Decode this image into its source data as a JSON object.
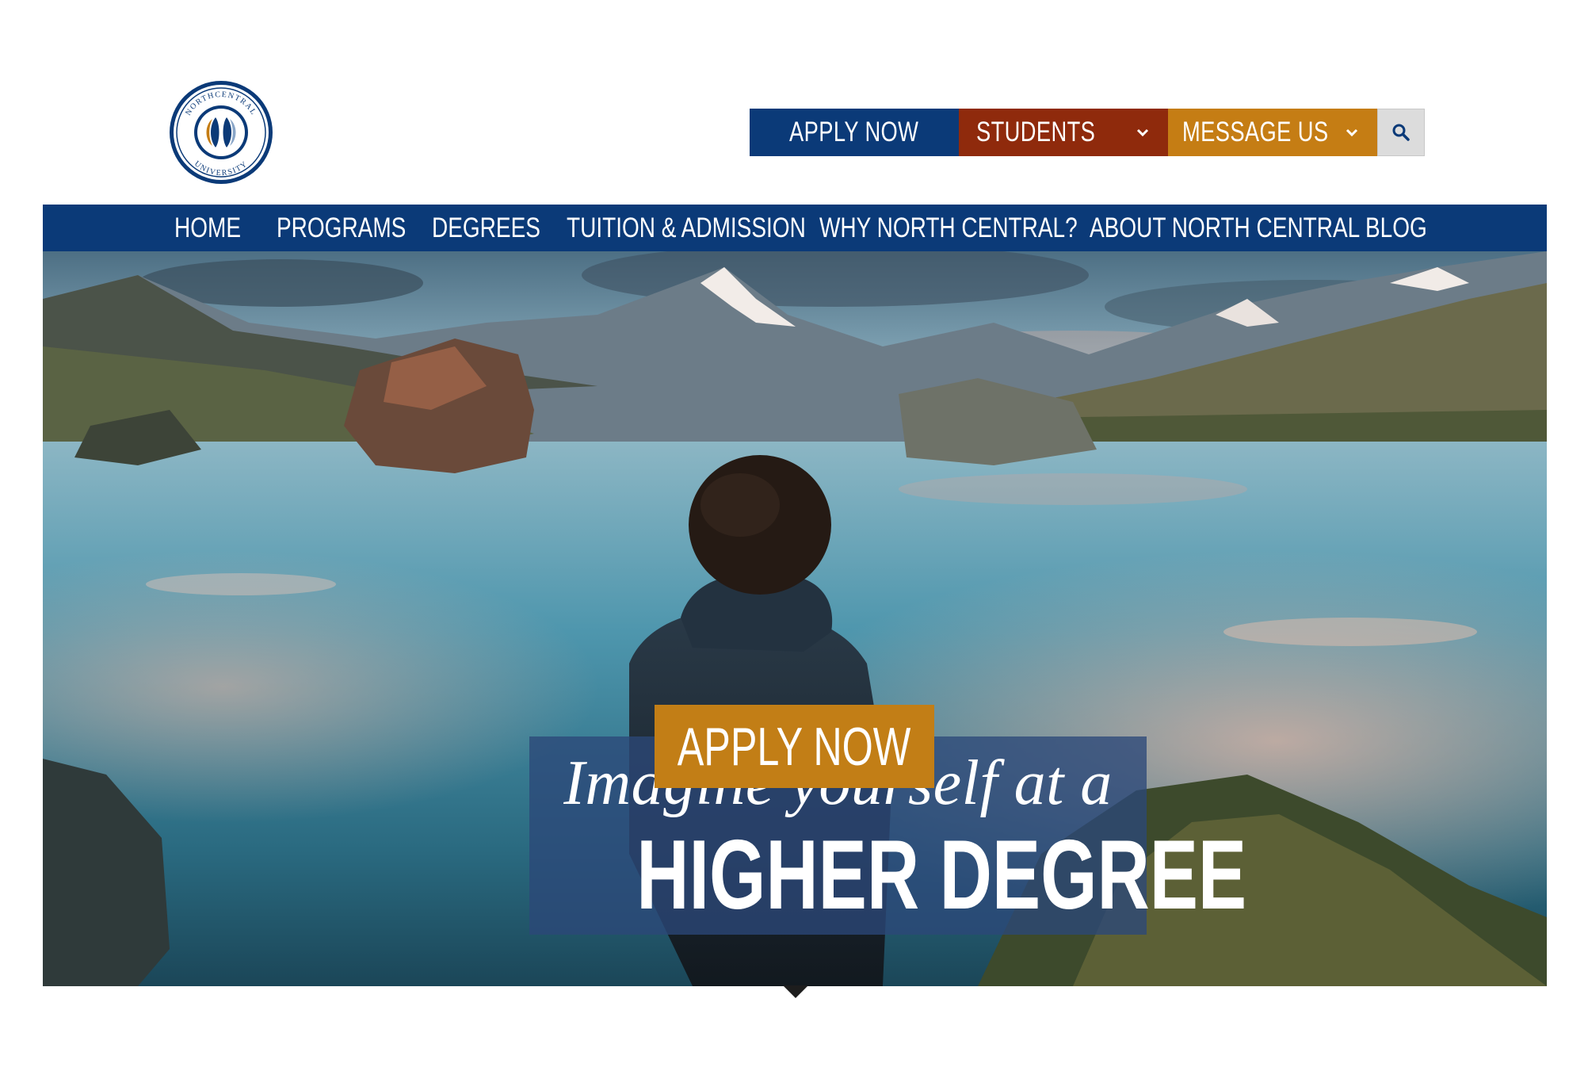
{
  "logo": {
    "name": "NORTHCENTRAL UNIVERSITY"
  },
  "utility": {
    "apply_label": "APPLY NOW",
    "students_label": "STUDENTS",
    "message_label": "MESSAGE US"
  },
  "nav": {
    "items": [
      {
        "label": "HOME"
      },
      {
        "label": "PROGRAMS"
      },
      {
        "label": "DEGREES"
      },
      {
        "label": "TUITION & ADMISSION"
      },
      {
        "label": "WHY NORTH CENTRAL?"
      },
      {
        "label": "ABOUT NORTH CENTRAL"
      },
      {
        "label": "BLOG"
      }
    ]
  },
  "hero": {
    "tagline": "Imagine yourself  at a",
    "headline": "HIGHER DEGREE",
    "cta_label": "APPLY NOW"
  },
  "colors": {
    "navy": "#0b3a78",
    "rust": "#8f2a0c",
    "gold": "#c57d14",
    "search_bg": "#dcdcdc"
  }
}
